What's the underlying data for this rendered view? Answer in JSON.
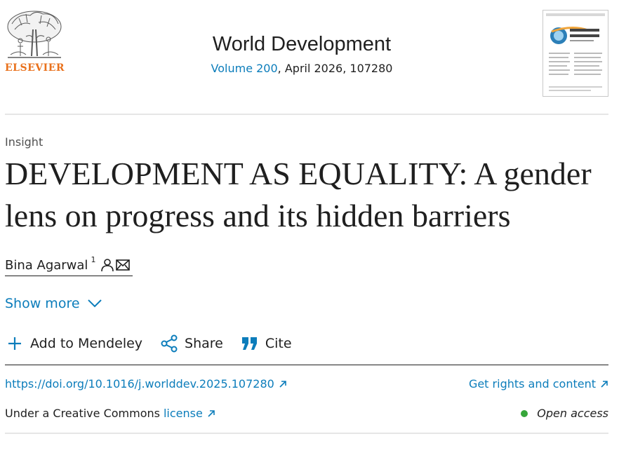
{
  "header": {
    "publisher": "ELSEVIER",
    "journal_title": "World Development",
    "volume_link": "Volume 200",
    "volume_rest": ", April 2026, 107280"
  },
  "article": {
    "type": "Insight",
    "title": "DEVELOPMENT AS EQUALITY: A gender lens on progress and its hidden barriers",
    "author": "Bina Agarwal",
    "author_sup": "1",
    "show_more": "Show more"
  },
  "toolbar": {
    "mendeley": "Add to Mendeley",
    "share": "Share",
    "cite": "Cite"
  },
  "links": {
    "doi": "https://doi.org/10.1016/j.worlddev.2025.107280",
    "rights": "Get rights and content"
  },
  "license": {
    "prefix": "Under a Creative Commons",
    "link": "license",
    "open_access": "Open access"
  },
  "colors": {
    "link": "#0c7dbb",
    "publisher_orange": "#e9711c",
    "open_access_green": "#36a63a"
  },
  "icons": [
    "elsevier-tree-logo",
    "person-icon",
    "mail-icon",
    "chevron-down-icon",
    "plus-icon",
    "share-icon",
    "quote-icon",
    "external-link-icon"
  ]
}
